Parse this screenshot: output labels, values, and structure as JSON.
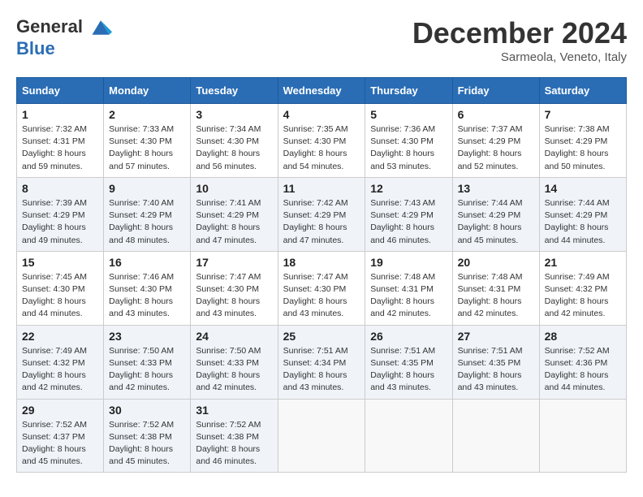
{
  "logo": {
    "line1": "General",
    "line2": "Blue"
  },
  "title": "December 2024",
  "subtitle": "Sarmeola, Veneto, Italy",
  "days_header": [
    "Sunday",
    "Monday",
    "Tuesday",
    "Wednesday",
    "Thursday",
    "Friday",
    "Saturday"
  ],
  "weeks": [
    [
      {
        "day": "1",
        "sunrise": "7:32 AM",
        "sunset": "4:31 PM",
        "daylight": "8 hours and 59 minutes."
      },
      {
        "day": "2",
        "sunrise": "7:33 AM",
        "sunset": "4:30 PM",
        "daylight": "8 hours and 57 minutes."
      },
      {
        "day": "3",
        "sunrise": "7:34 AM",
        "sunset": "4:30 PM",
        "daylight": "8 hours and 56 minutes."
      },
      {
        "day": "4",
        "sunrise": "7:35 AM",
        "sunset": "4:30 PM",
        "daylight": "8 hours and 54 minutes."
      },
      {
        "day": "5",
        "sunrise": "7:36 AM",
        "sunset": "4:30 PM",
        "daylight": "8 hours and 53 minutes."
      },
      {
        "day": "6",
        "sunrise": "7:37 AM",
        "sunset": "4:29 PM",
        "daylight": "8 hours and 52 minutes."
      },
      {
        "day": "7",
        "sunrise": "7:38 AM",
        "sunset": "4:29 PM",
        "daylight": "8 hours and 50 minutes."
      }
    ],
    [
      {
        "day": "8",
        "sunrise": "7:39 AM",
        "sunset": "4:29 PM",
        "daylight": "8 hours and 49 minutes."
      },
      {
        "day": "9",
        "sunrise": "7:40 AM",
        "sunset": "4:29 PM",
        "daylight": "8 hours and 48 minutes."
      },
      {
        "day": "10",
        "sunrise": "7:41 AM",
        "sunset": "4:29 PM",
        "daylight": "8 hours and 47 minutes."
      },
      {
        "day": "11",
        "sunrise": "7:42 AM",
        "sunset": "4:29 PM",
        "daylight": "8 hours and 47 minutes."
      },
      {
        "day": "12",
        "sunrise": "7:43 AM",
        "sunset": "4:29 PM",
        "daylight": "8 hours and 46 minutes."
      },
      {
        "day": "13",
        "sunrise": "7:44 AM",
        "sunset": "4:29 PM",
        "daylight": "8 hours and 45 minutes."
      },
      {
        "day": "14",
        "sunrise": "7:44 AM",
        "sunset": "4:29 PM",
        "daylight": "8 hours and 44 minutes."
      }
    ],
    [
      {
        "day": "15",
        "sunrise": "7:45 AM",
        "sunset": "4:30 PM",
        "daylight": "8 hours and 44 minutes."
      },
      {
        "day": "16",
        "sunrise": "7:46 AM",
        "sunset": "4:30 PM",
        "daylight": "8 hours and 43 minutes."
      },
      {
        "day": "17",
        "sunrise": "7:47 AM",
        "sunset": "4:30 PM",
        "daylight": "8 hours and 43 minutes."
      },
      {
        "day": "18",
        "sunrise": "7:47 AM",
        "sunset": "4:30 PM",
        "daylight": "8 hours and 43 minutes."
      },
      {
        "day": "19",
        "sunrise": "7:48 AM",
        "sunset": "4:31 PM",
        "daylight": "8 hours and 42 minutes."
      },
      {
        "day": "20",
        "sunrise": "7:48 AM",
        "sunset": "4:31 PM",
        "daylight": "8 hours and 42 minutes."
      },
      {
        "day": "21",
        "sunrise": "7:49 AM",
        "sunset": "4:32 PM",
        "daylight": "8 hours and 42 minutes."
      }
    ],
    [
      {
        "day": "22",
        "sunrise": "7:49 AM",
        "sunset": "4:32 PM",
        "daylight": "8 hours and 42 minutes."
      },
      {
        "day": "23",
        "sunrise": "7:50 AM",
        "sunset": "4:33 PM",
        "daylight": "8 hours and 42 minutes."
      },
      {
        "day": "24",
        "sunrise": "7:50 AM",
        "sunset": "4:33 PM",
        "daylight": "8 hours and 42 minutes."
      },
      {
        "day": "25",
        "sunrise": "7:51 AM",
        "sunset": "4:34 PM",
        "daylight": "8 hours and 43 minutes."
      },
      {
        "day": "26",
        "sunrise": "7:51 AM",
        "sunset": "4:35 PM",
        "daylight": "8 hours and 43 minutes."
      },
      {
        "day": "27",
        "sunrise": "7:51 AM",
        "sunset": "4:35 PM",
        "daylight": "8 hours and 43 minutes."
      },
      {
        "day": "28",
        "sunrise": "7:52 AM",
        "sunset": "4:36 PM",
        "daylight": "8 hours and 44 minutes."
      }
    ],
    [
      {
        "day": "29",
        "sunrise": "7:52 AM",
        "sunset": "4:37 PM",
        "daylight": "8 hours and 45 minutes."
      },
      {
        "day": "30",
        "sunrise": "7:52 AM",
        "sunset": "4:38 PM",
        "daylight": "8 hours and 45 minutes."
      },
      {
        "day": "31",
        "sunrise": "7:52 AM",
        "sunset": "4:38 PM",
        "daylight": "8 hours and 46 minutes."
      },
      null,
      null,
      null,
      null
    ]
  ],
  "labels": {
    "sunrise": "Sunrise:",
    "sunset": "Sunset:",
    "daylight": "Daylight:"
  }
}
